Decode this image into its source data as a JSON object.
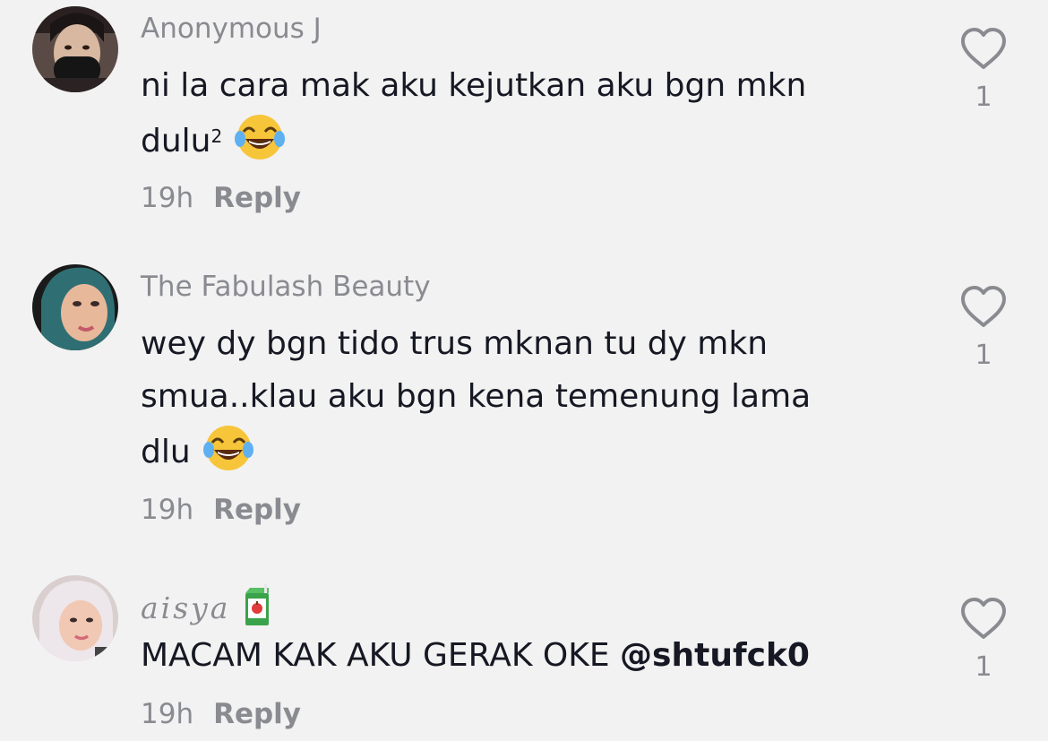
{
  "comments": [
    {
      "username": "Anonymous J",
      "lines": [
        "ni la cara mak aku kejutkan aku bgn mkn",
        "dulu"
      ],
      "superscript": "2",
      "emoji": "face-with-tears-of-joy",
      "time": "19h",
      "reply_label": "Reply",
      "likes": "1"
    },
    {
      "username": "The Fabulash Beauty",
      "lines": [
        "wey dy bgn tido trus mknan tu dy mkn",
        "smua..klau aku bgn kena temenung lama",
        "dlu"
      ],
      "emoji": "face-with-tears-of-joy",
      "time": "19h",
      "reply_label": "Reply",
      "likes": "1"
    },
    {
      "username": "aisya",
      "username_emoji": "juice-box",
      "text": "MACAM KAK AKU GERAK OKE ",
      "mention": "@shtufck0",
      "time": "19h",
      "reply_label": "Reply",
      "likes": "1"
    }
  ],
  "colors": {
    "background": "#f2f2f2",
    "text": "#161823",
    "secondary": "#8a8b91"
  }
}
